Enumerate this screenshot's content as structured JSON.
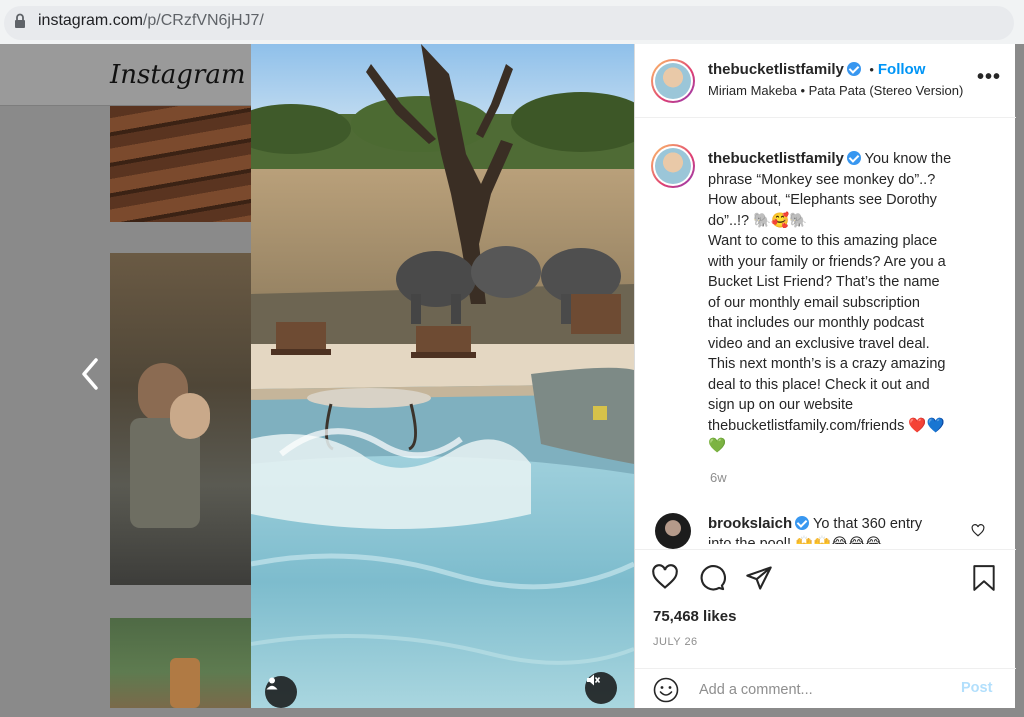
{
  "browser": {
    "url_domain": "instagram.com",
    "url_path": "/p/CRzfVN6jHJ7/"
  },
  "background_page": {
    "logo": "Instagram"
  },
  "post": {
    "username": "thebucketlistfamily",
    "follow_label": "Follow",
    "separator": "•",
    "audio": "Miriam Makeba • Pata Pata (Stereo Version)",
    "more_label": "•••",
    "caption_lines": [
      "You know the",
      "phrase “Monkey see monkey do”..?",
      "How about, “Elephants see Dorothy",
      "do”..!? 🐘🥰🐘",
      "Want to come to this amazing place",
      "with your family or friends? Are you a",
      "Bucket List Friend? That’s the name",
      "of our monthly email subscription",
      "that includes our monthly podcast",
      "video and an exclusive travel deal.",
      "This next month’s is a crazy amazing",
      "deal to this place! Check it out and",
      "sign up on our website",
      "thebucketlistfamily.com/friends ❤️💙",
      "💚"
    ],
    "time_ago": "6w",
    "comment": {
      "username": "brookslaich",
      "text_line1": "Yo that 360 entry",
      "text_line2": "into the pool! 🙌🙌😂😂😂"
    },
    "likes": "75,468 likes",
    "date": "JULY 26",
    "add_comment_placeholder": "Add a comment...",
    "post_label": "Post"
  },
  "icons": {
    "lock": "lock-icon",
    "prev": "chevron-left-icon",
    "user_tag": "user-tag-icon",
    "mute": "muted-speaker-icon",
    "like": "heart-icon",
    "comment": "comment-icon",
    "share": "send-icon",
    "save": "bookmark-icon",
    "emoji": "smiley-icon"
  },
  "colors": {
    "link_blue": "#0095f6",
    "post_disabled": "#b2dffc",
    "verified": "#3897f0"
  }
}
